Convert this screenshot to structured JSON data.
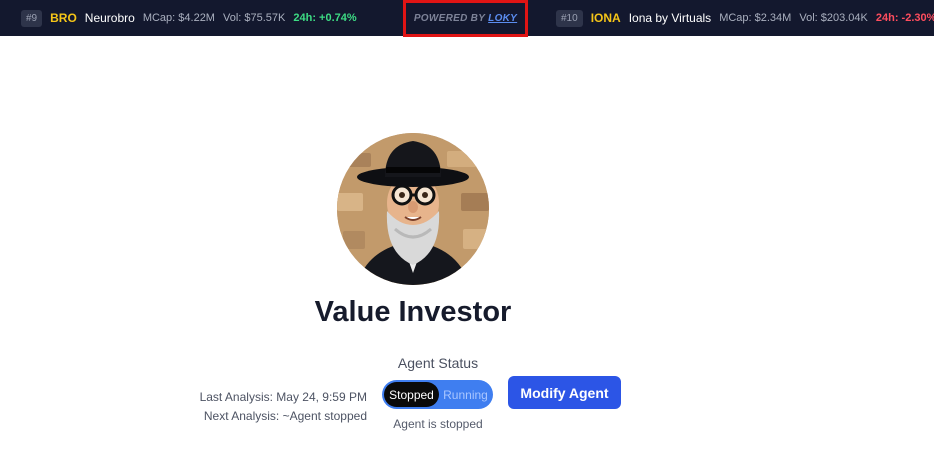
{
  "ticker": {
    "left": {
      "rank": "#9",
      "symbol": "BRO",
      "name": "Neurobro",
      "mcap": "MCap: $4.22M",
      "vol": "Vol: $75.57K",
      "change": "24h: +0.74%"
    },
    "right": {
      "rank": "#10",
      "symbol": "IONA",
      "name": "Iona by Virtuals",
      "mcap": "MCap: $2.34M",
      "vol": "Vol: $203.04K",
      "change": "24h: -2.30%"
    },
    "powered_prefix": "POWERED BY",
    "powered_link": "LOKY"
  },
  "agent": {
    "name": "Value Investor",
    "status_label": "Agent Status",
    "toggle_active": "Stopped",
    "toggle_inactive": "Running",
    "status_note": "Agent is stopped",
    "last_analysis": "Last Analysis: May 24, 9:59 PM",
    "next_analysis": "Next Analysis: ~Agent stopped",
    "modify_label": "Modify Agent"
  },
  "colors": {
    "ticker_bg": "#13182e",
    "symbol": "#f5c518",
    "positive": "#3ddc84",
    "negative": "#ff4d5e",
    "primary_button": "#2c55e6",
    "highlight_box": "#e01414"
  }
}
